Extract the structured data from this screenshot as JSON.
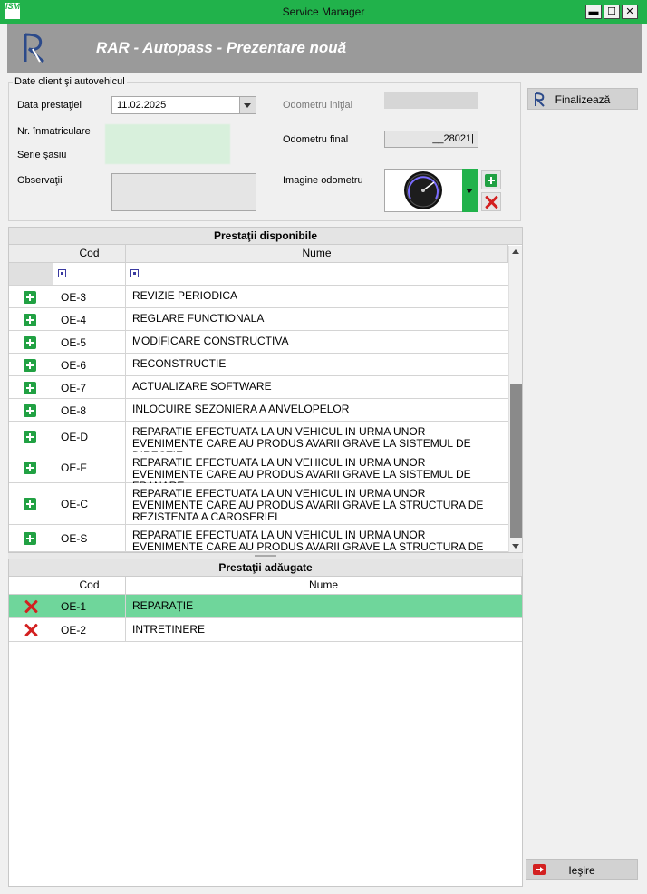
{
  "window": {
    "title": "Service Manager",
    "app_logo_text": "ISM",
    "minimize": "▬",
    "maximize": "☐",
    "close": "✕"
  },
  "banner": {
    "logo": "R",
    "title": "RAR - Autopass  -  Prezentare nouă"
  },
  "client_group": {
    "legend": "Date client şi autovehicul",
    "data_label": "Data prestaţiei",
    "data_value": "11.02.2025",
    "nr_label": "Nr. înmatriculare",
    "serie_label": "Serie şasiu",
    "observatii_label": "Observaţii",
    "odometru_initial_label": "Odometru iniţial",
    "odometru_final_label": "Odometru final",
    "odometru_final_value": "__28021|",
    "imagine_label": "Imagine odometru"
  },
  "buttons": {
    "finalizeaza": "Finalizează",
    "iesire": "Ieşire"
  },
  "disponibile": {
    "title": "Prestaţii disponibile",
    "col_cod": "Cod",
    "col_nume": "Nume",
    "rows": [
      {
        "cod": "OE-3",
        "nume": "REVIZIE PERIODICA"
      },
      {
        "cod": "OE-4",
        "nume": "REGLARE FUNCTIONALA"
      },
      {
        "cod": "OE-5",
        "nume": "MODIFICARE CONSTRUCTIVA"
      },
      {
        "cod": "OE-6",
        "nume": "RECONSTRUCTIE"
      },
      {
        "cod": "OE-7",
        "nume": "ACTUALIZARE SOFTWARE"
      },
      {
        "cod": "OE-8",
        "nume": "INLOCUIRE SEZONIERA A ANVELOPELOR"
      },
      {
        "cod": "OE-D",
        "nume": "REPARATIE EFECTUATA LA UN VEHICUL IN URMA UNOR EVENIMENTE CARE AU PRODUS AVARII GRAVE LA SISTEMUL DE DIRECTIE"
      },
      {
        "cod": "OE-F",
        "nume": "REPARATIE EFECTUATA LA UN VEHICUL IN URMA UNOR EVENIMENTE CARE AU PRODUS AVARII GRAVE LA SISTEMUL DE FRANARE"
      },
      {
        "cod": "OE-C",
        "nume": "REPARATIE EFECTUATA LA UN VEHICUL IN URMA UNOR EVENIMENTE CARE AU PRODUS AVARII GRAVE LA STRUCTURA DE REZISTENTA A CAROSERIEI"
      },
      {
        "cod": "OE-S",
        "nume": "REPARATIE EFECTUATA LA UN VEHICUL IN URMA UNOR EVENIMENTE CARE AU PRODUS AVARII GRAVE LA STRUCTURA DE REZISTENTA A ŞASIULUI"
      }
    ]
  },
  "adaugate": {
    "title": "Prestaţii adăugate",
    "col_cod": "Cod",
    "col_nume": "Nume",
    "rows": [
      {
        "cod": "OE-1",
        "nume": "REPARAȚIE"
      },
      {
        "cod": "OE-2",
        "nume": "INTRETINERE"
      }
    ]
  },
  "colors": {
    "accent_green": "#21b24b",
    "selected_row": "#6fd69b",
    "banner_gray": "#9a9a9a"
  }
}
